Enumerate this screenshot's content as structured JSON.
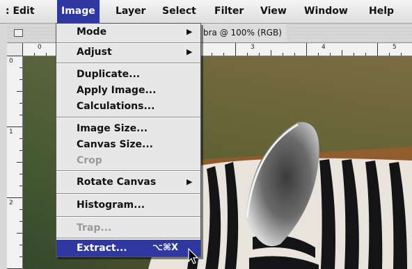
{
  "menubar": {
    "items": [
      {
        "label": ": Edit"
      },
      {
        "label": "Image"
      },
      {
        "label": "Layer"
      },
      {
        "label": "Select"
      },
      {
        "label": "Filter"
      },
      {
        "label": "View"
      },
      {
        "label": "Window"
      },
      {
        "label": "Help"
      }
    ]
  },
  "window": {
    "title": "bra @ 100% (RGB)"
  },
  "rulers": {
    "horizontal_labels": [
      "0",
      "1",
      "2",
      "3",
      "4",
      "5"
    ],
    "vertical_labels": [
      "0",
      "1",
      "2"
    ]
  },
  "image_menu": {
    "items": [
      {
        "label": "Mode",
        "submenu": true
      },
      {
        "label": "Adjust",
        "submenu": true
      },
      {
        "label": "Duplicate..."
      },
      {
        "label": "Apply Image..."
      },
      {
        "label": "Calculations..."
      },
      {
        "label": "Image Size..."
      },
      {
        "label": "Canvas Size..."
      },
      {
        "label": "Crop",
        "disabled": true
      },
      {
        "label": "Rotate Canvas",
        "submenu": true
      },
      {
        "label": "Histogram..."
      },
      {
        "label": "Trap...",
        "disabled": true
      },
      {
        "label": "Extract...",
        "shortcut": "⌥⌘X",
        "selected": true
      }
    ]
  },
  "icons": {
    "submenu_arrow": "triangle-right-icon",
    "cursor": "arrow-cursor-icon",
    "close_box": "close-box-icon"
  },
  "colors": {
    "menu_highlight": "#2f38a0",
    "menu_bg": "#e7e7e7",
    "disabled_text": "#9a9a9a"
  }
}
